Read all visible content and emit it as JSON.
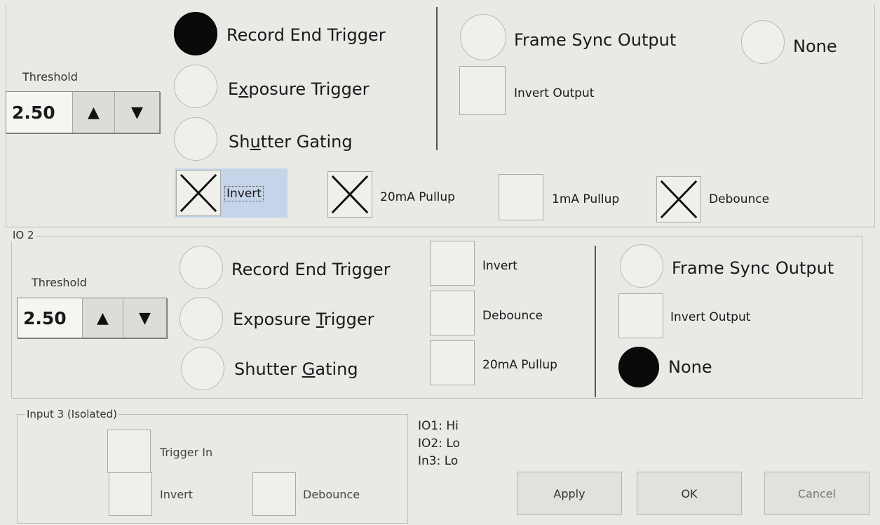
{
  "io1": {
    "threshold_label": "Threshold",
    "threshold_value": "2.50",
    "modes": [
      {
        "pre": "Record End Trigger",
        "u": "",
        "post": "",
        "selected": true
      },
      {
        "pre": "E",
        "u": "x",
        "post": "posure Trigger",
        "selected": false
      },
      {
        "pre": "Sh",
        "u": "u",
        "post": "tter Gating",
        "selected": false
      }
    ],
    "options": [
      {
        "label": "Invert",
        "checked": true
      },
      {
        "label": "20mA Pullup",
        "checked": true
      },
      {
        "label": "1mA Pullup",
        "checked": false
      },
      {
        "label": "Debounce",
        "checked": true
      }
    ],
    "output": {
      "frame_sync_label": "Frame Sync Output",
      "frame_sync_selected": false,
      "none_label": "None",
      "none_selected": false,
      "invert_output_label": "Invert Output",
      "invert_output_checked": false
    }
  },
  "io2": {
    "title": "IO 2",
    "threshold_label": "Threshold",
    "threshold_value": "2.50",
    "modes": [
      {
        "pre": "Record End Trigger",
        "u": "",
        "post": "",
        "selected": false
      },
      {
        "pre": "Exposure ",
        "u": "T",
        "post": "rigger",
        "selected": false
      },
      {
        "pre": "Shutter ",
        "u": "G",
        "post": "ating",
        "selected": false
      }
    ],
    "options": [
      {
        "label": "Invert",
        "checked": false
      },
      {
        "label": "Debounce",
        "checked": false
      },
      {
        "label": "20mA Pullup",
        "checked": false
      }
    ],
    "output": {
      "frame_sync_label": "Frame Sync Output",
      "frame_sync_selected": false,
      "invert_output_label": "Invert Output",
      "invert_output_checked": false,
      "none_label": "None",
      "none_selected": true
    }
  },
  "input3": {
    "title": "Input 3 (Isolated)",
    "trigger_in_label": "Trigger In",
    "invert_label": "Invert",
    "debounce_label": "Debounce"
  },
  "status": [
    "IO1: Hi",
    "IO2: Lo",
    "In3: Lo"
  ],
  "buttons": {
    "apply": "Apply",
    "ok": "OK",
    "cancel": "Cancel"
  },
  "icons": {
    "up": "triangle-up-icon",
    "down": "triangle-down-icon",
    "check": "x-mark-icon"
  }
}
